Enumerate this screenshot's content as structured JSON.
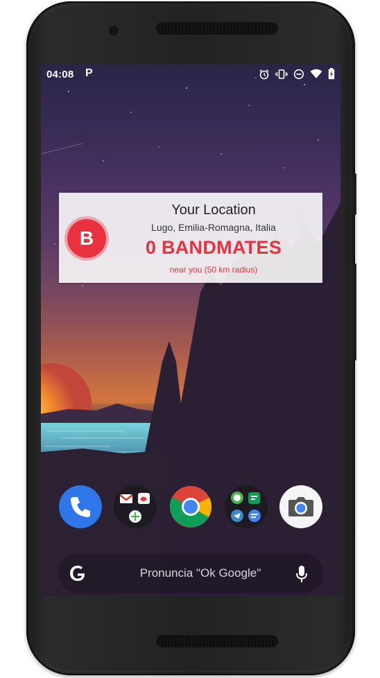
{
  "status_bar": {
    "time": "04:08",
    "notif_icon": "P"
  },
  "widget": {
    "logo_letter": "B",
    "title": "Your Location",
    "place": "Lugo, Emilia-Romagna, Italia",
    "count": "0 BANDMATES",
    "subtitle": "near you (50 km radius)",
    "accent": "#e8323f"
  },
  "dock": {
    "apps": [
      "phone-icon",
      "google-apps-folder-icon",
      "chrome-icon",
      "messaging-folder-icon",
      "camera-icon"
    ]
  },
  "search_bar": {
    "hint": "Pronuncia \"Ok Google\""
  }
}
